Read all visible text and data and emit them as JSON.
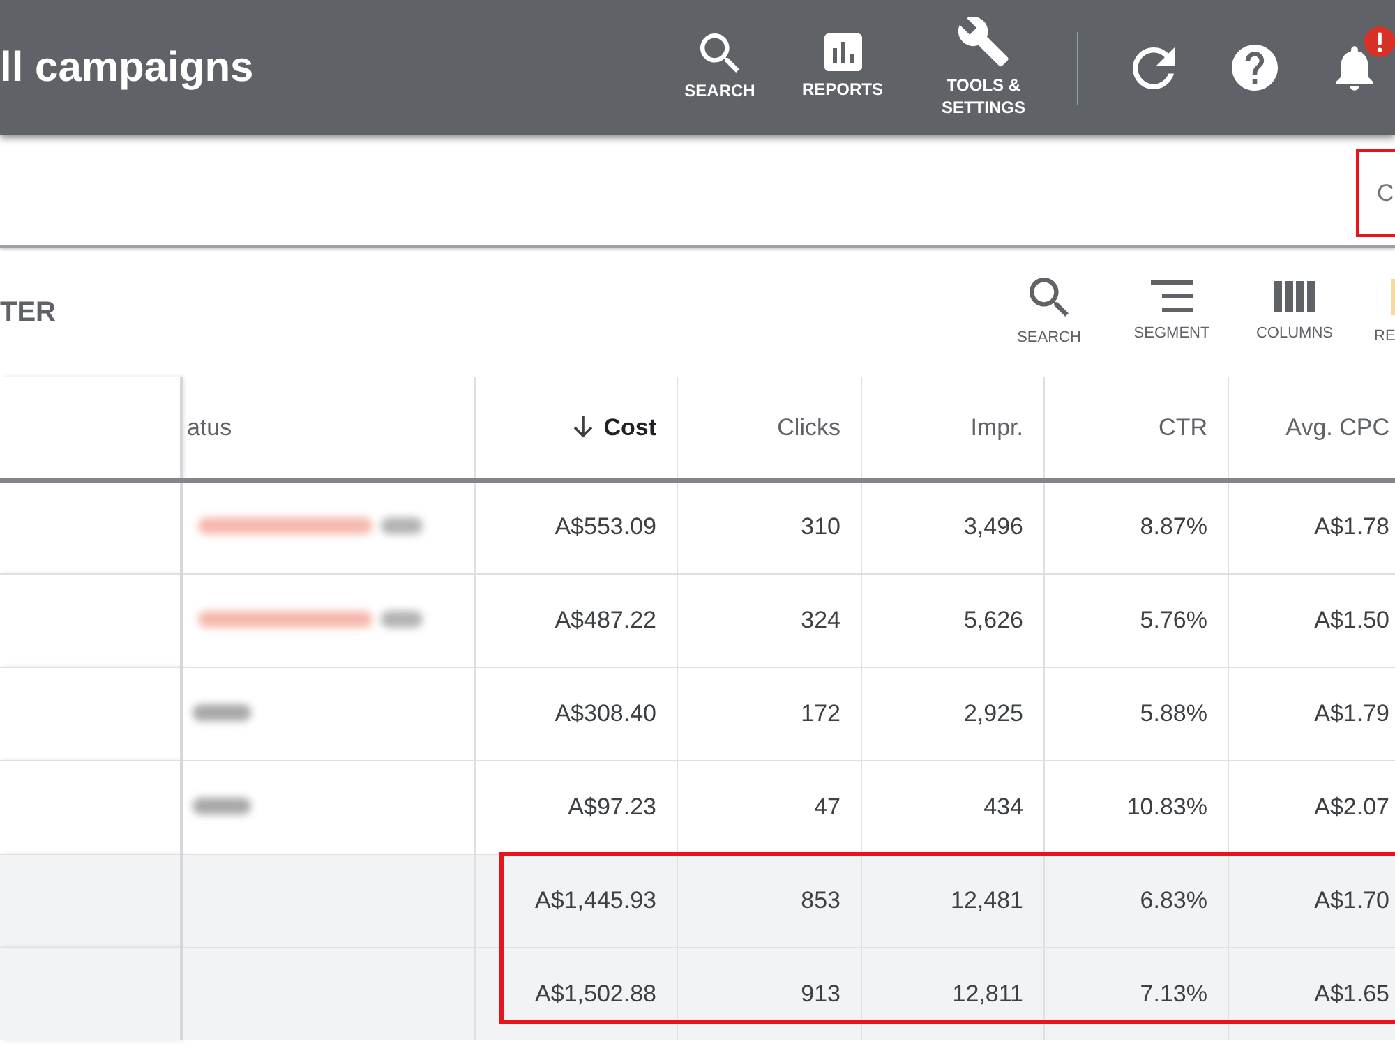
{
  "header": {
    "title": "ll campaigns",
    "actions": [
      {
        "kind": "search",
        "label": "SEARCH"
      },
      {
        "kind": "reports",
        "label": "REPORTS"
      },
      {
        "kind": "tools",
        "label": "TOOLS & SETTINGS"
      }
    ],
    "icon_buttons": [
      {
        "kind": "refresh"
      },
      {
        "kind": "help"
      },
      {
        "kind": "notifications",
        "alert": true
      }
    ]
  },
  "filter_bar": {
    "field_text": "C",
    "highlighted": true
  },
  "toolbar": {
    "label": "TER",
    "tools": [
      {
        "kind": "search",
        "label": "SEARCH"
      },
      {
        "kind": "segment",
        "label": "SEGMENT"
      },
      {
        "kind": "columns",
        "label": "COLUMNS"
      },
      {
        "kind": "partial",
        "label": "RE"
      }
    ]
  },
  "table": {
    "columns": [
      {
        "label": "atus",
        "kind": "text",
        "sorted": false
      },
      {
        "label": "Cost",
        "kind": "number",
        "sorted": true
      },
      {
        "label": "Clicks",
        "kind": "number",
        "sorted": false
      },
      {
        "label": "Impr.",
        "kind": "number",
        "sorted": false
      },
      {
        "label": "CTR",
        "kind": "number",
        "sorted": false
      },
      {
        "label": "Avg. CPC",
        "kind": "number",
        "sorted": false
      }
    ],
    "rows": [
      {
        "status_blur": {
          "kind": "badge",
          "color": "#f5b8ad"
        },
        "cells": [
          "",
          "A$553.09",
          "310",
          "3,496",
          "8.87%",
          "A$1.78"
        ],
        "total": false,
        "highlighted": false
      },
      {
        "status_blur": {
          "kind": "badge",
          "color": "#f5b8ad"
        },
        "cells": [
          "",
          "A$487.22",
          "324",
          "5,626",
          "5.76%",
          "A$1.50"
        ],
        "total": false,
        "highlighted": false
      },
      {
        "status_blur": {
          "kind": "text",
          "color": "#a8a8a8"
        },
        "cells": [
          "",
          "A$308.40",
          "172",
          "2,925",
          "5.88%",
          "A$1.79"
        ],
        "total": false,
        "highlighted": false
      },
      {
        "status_blur": {
          "kind": "text",
          "color": "#a8a8a8"
        },
        "cells": [
          "",
          "A$97.23",
          "47",
          "434",
          "10.83%",
          "A$2.07"
        ],
        "total": false,
        "highlighted": false
      },
      {
        "cells": [
          "",
          "A$1,445.93",
          "853",
          "12,481",
          "6.83%",
          "A$1.70"
        ],
        "total": true,
        "highlighted": true
      },
      {
        "cells": [
          "",
          "A$1,502.88",
          "913",
          "12,811",
          "7.13%",
          "A$1.65"
        ],
        "total": true,
        "highlighted": true
      }
    ]
  }
}
